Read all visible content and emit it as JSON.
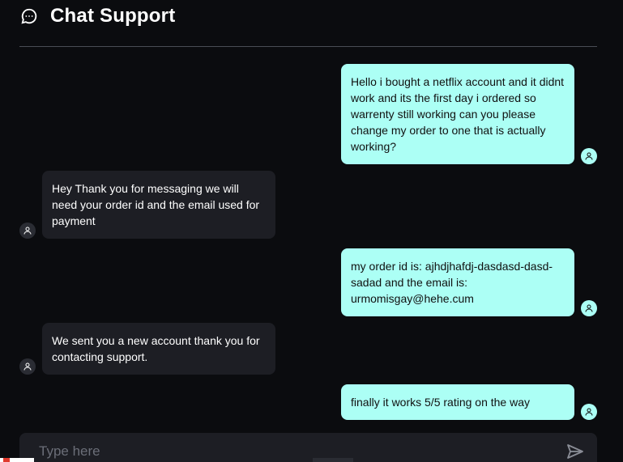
{
  "header": {
    "title": "Chat Support",
    "icon": "chat-bubble-icon"
  },
  "messages": [
    {
      "role": "user",
      "text": "Hello i bought a netflix account and it didnt work and its the first day i ordered so warrenty still working can you please change my order to one that is actually working?"
    },
    {
      "role": "agent",
      "text": "Hey Thank you for messaging we will need your order id and the email used for payment"
    },
    {
      "role": "user",
      "text": "my order id is: ajhdjhafdj-dasdasd-dasd-sadad and the email is: urmomisgay@hehe.cum"
    },
    {
      "role": "agent",
      "text": "We sent you a new account thank you for contacting support."
    },
    {
      "role": "user",
      "text": "finally it works 5/5 rating on the way"
    }
  ],
  "composer": {
    "placeholder": "Type here",
    "value": "",
    "send_icon": "send-icon"
  },
  "colors": {
    "background": "#0b0c0f",
    "user_bubble": "#acfff5",
    "agent_bubble": "#1d1e24",
    "divider": "#4a4d55"
  }
}
